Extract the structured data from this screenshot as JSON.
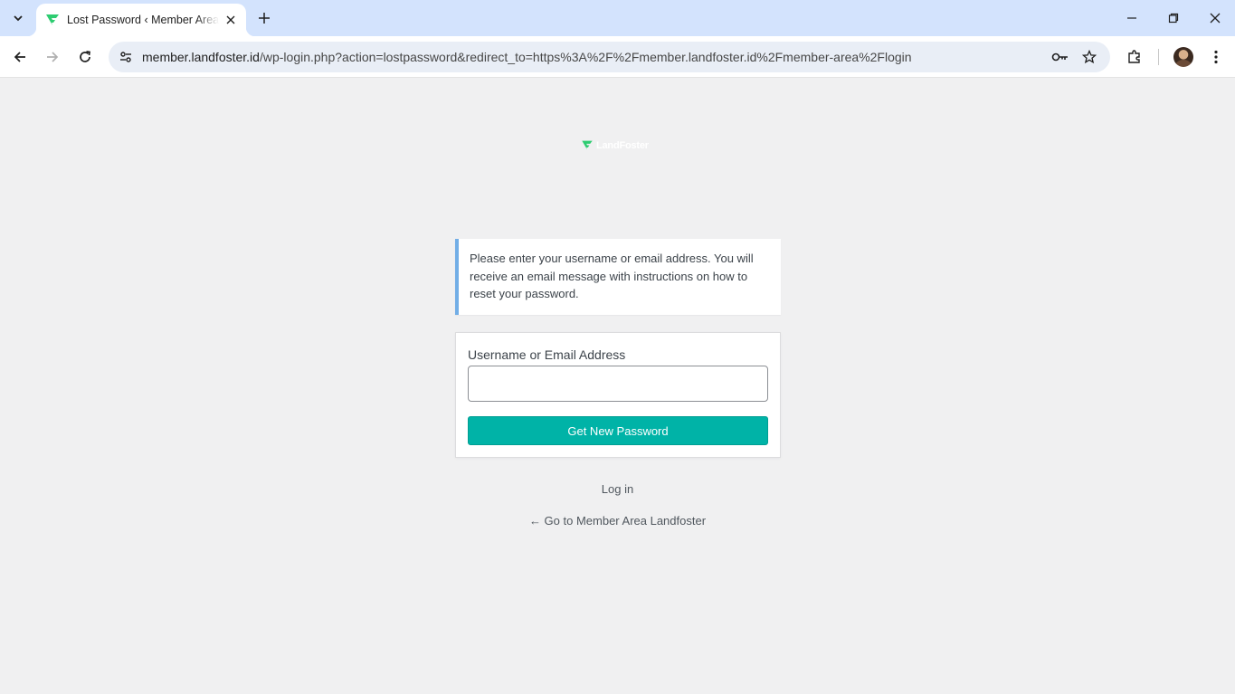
{
  "browser": {
    "tab_title": "Lost Password ‹ Member Area Landfoster",
    "url_host": "member.landfoster.id",
    "url_path": "/wp-login.php?action=lostpassword&redirect_to=https%3A%2F%2Fmember.landfoster.id%2Fmember-area%2Flogin"
  },
  "logo": {
    "text": "LandFoster",
    "color": "#2ecc71"
  },
  "notice": {
    "message": "Please enter your username or email address. You will receive an email message with instructions on how to reset your password."
  },
  "form": {
    "label": "Username or Email Address",
    "input_value": "",
    "submit_label": "Get New Password",
    "accent": "#00b3a7"
  },
  "links": {
    "login": "Log in",
    "back": "← Go to Member Area Landfoster"
  }
}
